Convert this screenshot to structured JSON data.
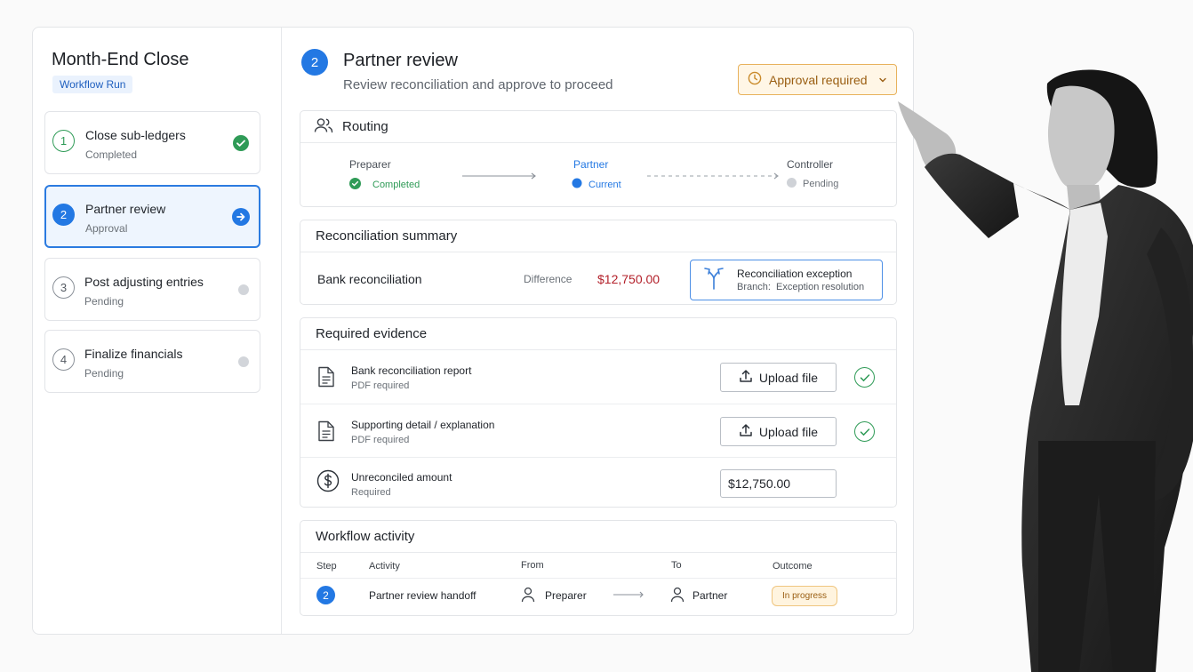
{
  "sidebar": {
    "title": "Month-End Close",
    "badge": "Workflow Run",
    "steps": [
      {
        "num": "1",
        "name": "Close sub-ledgers",
        "status": "Completed"
      },
      {
        "num": "2",
        "name": "Partner review",
        "status": "Approval"
      },
      {
        "num": "3",
        "name": "Post adjusting entries",
        "status": "Pending"
      },
      {
        "num": "4",
        "name": "Finalize financials",
        "status": "Pending"
      }
    ]
  },
  "header": {
    "step_num": "2",
    "title": "Partner review",
    "subtitle": "Review reconciliation and approve to proceed",
    "approval_label": "Approval required"
  },
  "routing": {
    "title": "Routing",
    "nodes": [
      {
        "label": "Preparer",
        "state": "Completed"
      },
      {
        "label": "Partner",
        "state": "Current"
      },
      {
        "label": "Controller",
        "state": "Pending"
      }
    ]
  },
  "reconciliation": {
    "title": "Reconciliation summary",
    "item": "Bank reconciliation",
    "difference_label": "Difference",
    "difference_value": "$12,750.00",
    "exception_title": "Reconciliation exception",
    "exception_branch_label": "Branch:",
    "exception_branch_value": "Exception resolution"
  },
  "evidence": {
    "title": "Required evidence",
    "items": [
      {
        "name": "Bank reconciliation report",
        "req": "PDF required",
        "action": "Upload file"
      },
      {
        "name": "Supporting detail / explanation",
        "req": "PDF required",
        "action": "Upload file"
      },
      {
        "name": "Unreconciled amount",
        "req": "Required",
        "value": "$12,750.00"
      }
    ]
  },
  "activity": {
    "title": "Workflow activity",
    "columns": [
      "Step",
      "Activity",
      "From",
      "To",
      "Outcome"
    ],
    "rows": [
      {
        "step": "2",
        "activity": "Partner review handoff",
        "from": "Preparer",
        "to": "Partner",
        "outcome": "In progress"
      }
    ]
  },
  "colors": {
    "accent": "#2378e3",
    "success": "#2f9b57",
    "warning": "#e8b25c",
    "danger": "#b3202a"
  }
}
